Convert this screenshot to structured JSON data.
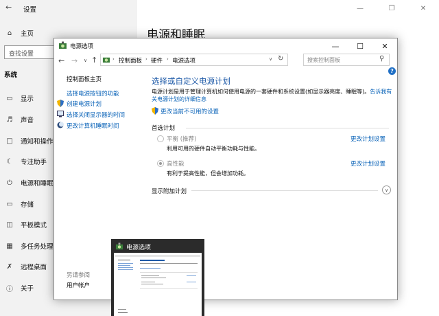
{
  "settings": {
    "title": "设置",
    "home": "主页",
    "search_placeholder": "查找设置",
    "section": "系统",
    "page_title": "电源和睡眠",
    "nav": [
      "显示",
      "声音",
      "通知和操作",
      "专注助手",
      "电源和睡眠",
      "存储",
      "平板模式",
      "多任务处理",
      "远程桌面",
      "关于"
    ]
  },
  "dialog": {
    "title": "电源选项",
    "breadcrumb": [
      "控制面板",
      "硬件",
      "电源选项"
    ],
    "search_placeholder": "搜索控制面板",
    "left_nav": {
      "home": "控制面板主页",
      "links": [
        "选择电源按钮的功能",
        "创建电源计划",
        "选择关闭显示器的时间",
        "更改计算机睡眠时间"
      ],
      "see_also": "另请参阅",
      "see_also_link": "用户帐户"
    },
    "heading": "选择或自定义电源计划",
    "description": "电源计划是用于管理计算机如何使用电源的一套硬件和系统设置(如显示器亮度、睡眠等)。",
    "description_link_1": "告诉我有关",
    "description_link_2": "电源计划的详细信息",
    "shield_link": "更改当前不可用的设置",
    "preferred_label": "首选计划",
    "plans": [
      {
        "name": "平衡 (推荐)",
        "desc": "利用可用的硬件自动平衡功耗与性能。",
        "link": "更改计划设置",
        "selected": false
      },
      {
        "name": "高性能",
        "desc": "有利于提高性能，但会增加功耗。",
        "link": "更改计划设置",
        "selected": true
      }
    ],
    "extra_plans": "显示附加计划"
  },
  "thumbnail": {
    "title": "电源选项"
  },
  "colors": {
    "accent": "#0a63b8",
    "heading": "#1e5aa8",
    "sidebar_bg": "#f2f2f2"
  }
}
